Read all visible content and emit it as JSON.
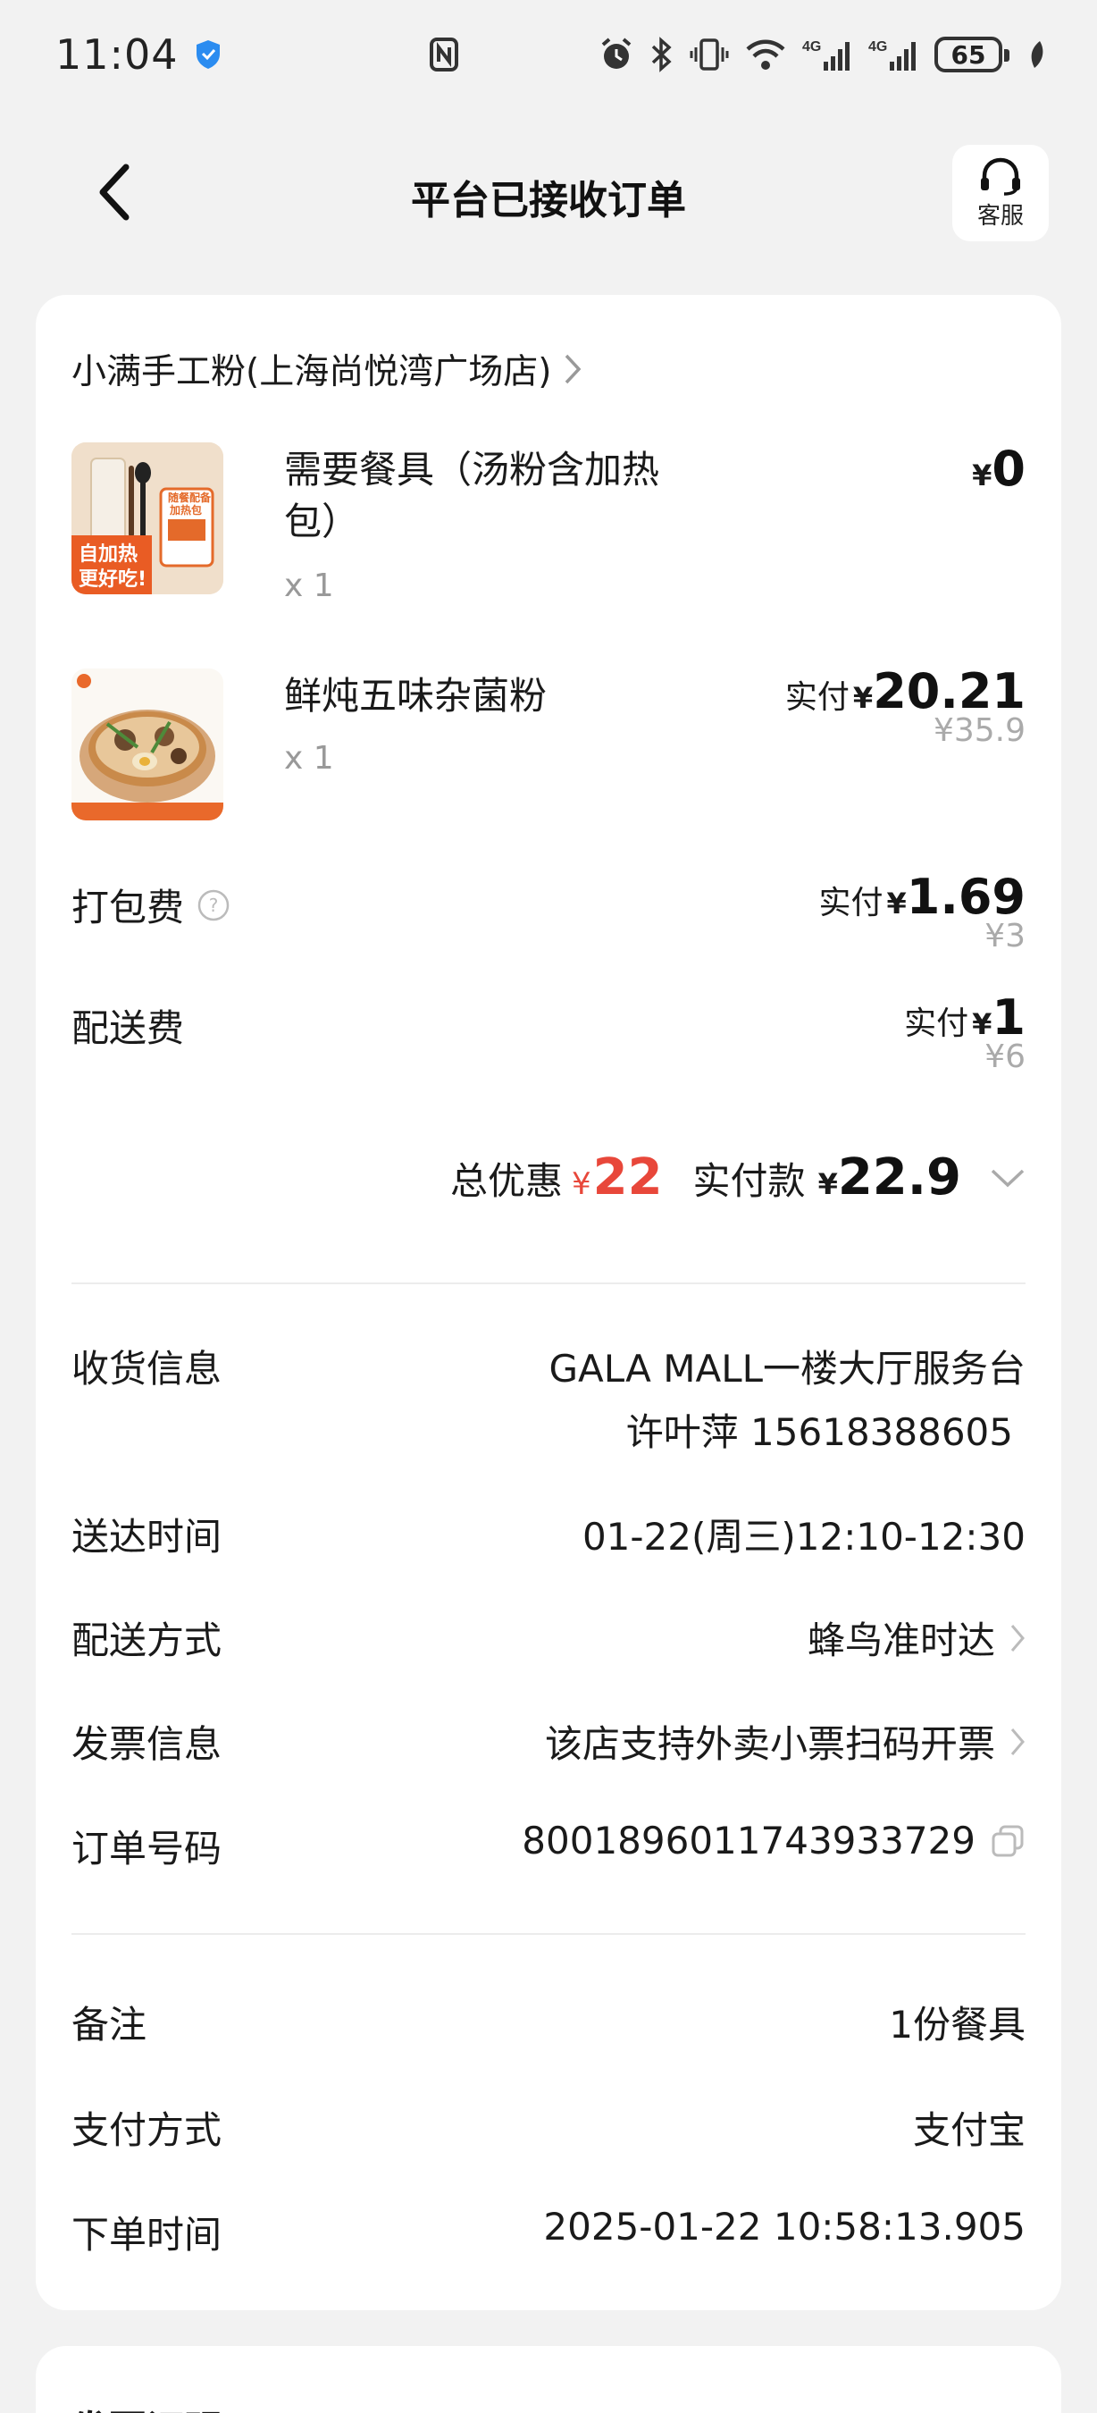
{
  "status_bar": {
    "time": "11:04",
    "battery": "65",
    "network_1": "4G",
    "network_2": "4G"
  },
  "header": {
    "title": "平台已接收订单",
    "service_label": "客服"
  },
  "store": {
    "name": "小满手工粉(上海尚悦湾广场店)"
  },
  "items": [
    {
      "name": "需要餐具（汤粉含加热包）",
      "qty": "x 1",
      "price": "0",
      "currency": "¥",
      "thumb_text_1": "自加热",
      "thumb_text_2": "更好吃!",
      "thumb_text_3": "随餐配备",
      "thumb_text_4": "加热包"
    },
    {
      "name": "鲜炖五味杂菌粉",
      "qty": "x 1",
      "paid_label": "实付",
      "currency": "¥",
      "price": "20.21",
      "original_price": "¥35.9"
    }
  ],
  "fees": [
    {
      "label": "打包费",
      "paid_label": "实付",
      "currency": "¥",
      "price": "1.69",
      "original_price": "¥3"
    },
    {
      "label": "配送费",
      "paid_label": "实付",
      "currency": "¥",
      "price": "1",
      "original_price": "¥6"
    }
  ],
  "totals": {
    "discount_label": "总优惠",
    "currency": "¥",
    "discount": "22",
    "paid_label": "实付款",
    "paid": "22.9"
  },
  "delivery_info": [
    {
      "label": "收货信息",
      "value": "GALA MALL一楼大厅服务台",
      "value2": "许叶萍 15618388605"
    },
    {
      "label": "送达时间",
      "value": "01-22(周三)12:10-12:30"
    },
    {
      "label": "配送方式",
      "value": "蜂鸟准时达"
    },
    {
      "label": "发票信息",
      "value": "该店支持外卖小票扫码开票"
    },
    {
      "label": "订单号码",
      "value": "8001896011743933729"
    }
  ],
  "order_info": [
    {
      "label": "备注",
      "value": "1份餐具"
    },
    {
      "label": "支付方式",
      "value": "支付宝"
    },
    {
      "label": "下单时间",
      "value": "2025-01-22 10:58:13.905"
    }
  ],
  "next_section": {
    "title": "发票证明"
  },
  "colors": {
    "accent_red": "#e8473a",
    "background": "#f2f2f2",
    "card": "#ffffff"
  }
}
